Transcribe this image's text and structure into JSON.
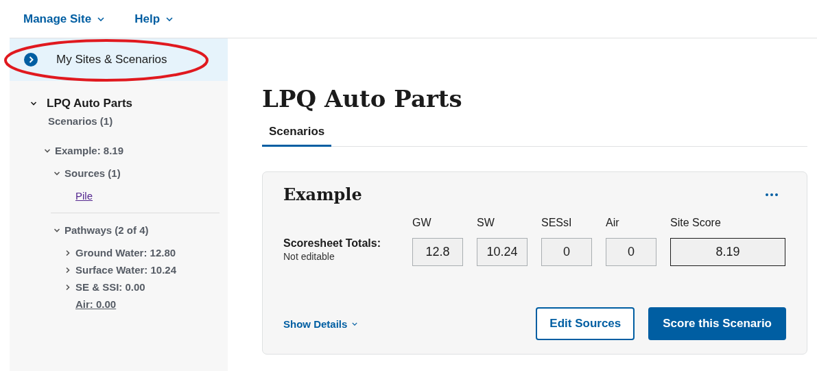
{
  "top_menu": [
    {
      "label": "Manage Site"
    },
    {
      "label": "Help"
    }
  ],
  "sidebar": {
    "nav_item": {
      "label": "My Sites & Scenarios"
    },
    "annotation": {
      "kind": "ellipse"
    },
    "tree": [
      {
        "label": "LPQ Auto Parts",
        "kind": "site",
        "expanded": true,
        "children": [
          {
            "label": "Scenarios (1)",
            "kind": "plain",
            "children": [
              {
                "label": "Example: 8.19",
                "expanded": true,
                "children": [
                  {
                    "label": "Sources (1)",
                    "expanded": true,
                    "children": [
                      {
                        "label": "Pile",
                        "kind": "link"
                      }
                    ]
                  },
                  {
                    "label": "Pathways (2 of 4)",
                    "expanded": true,
                    "children": [
                      {
                        "label": "Ground Water: 12.80",
                        "expanded": false
                      },
                      {
                        "label": "Surface Water: 10.24",
                        "expanded": false
                      },
                      {
                        "label": "SE & SSI: 0.00",
                        "expanded": false
                      },
                      {
                        "label": "Air: 0.00",
                        "kind": "underlined"
                      }
                    ]
                  }
                ]
              }
            ]
          }
        ]
      }
    ]
  },
  "main": {
    "title": "LPQ Auto Parts",
    "tabs": [
      {
        "label": "Scenarios",
        "selected": true
      }
    ],
    "card": {
      "title": "Example",
      "totals_label": "Scoresheet Totals:",
      "totals_note": "Not editable",
      "columns": [
        {
          "label": "GW",
          "value": "12.8",
          "kind": "pathway"
        },
        {
          "label": "SW",
          "value": "10.24",
          "kind": "pathway"
        },
        {
          "label": "SESsI",
          "value": "0",
          "kind": "pathway"
        },
        {
          "label": "Air",
          "value": "0",
          "kind": "pathway"
        },
        {
          "label": "Site Score",
          "value": "8.19",
          "kind": "total"
        }
      ],
      "show_details": "Show Details",
      "buttons": [
        {
          "label": "Edit Sources",
          "kind": "secondary"
        },
        {
          "label": "Score this Scenario",
          "kind": "primary"
        }
      ]
    }
  }
}
